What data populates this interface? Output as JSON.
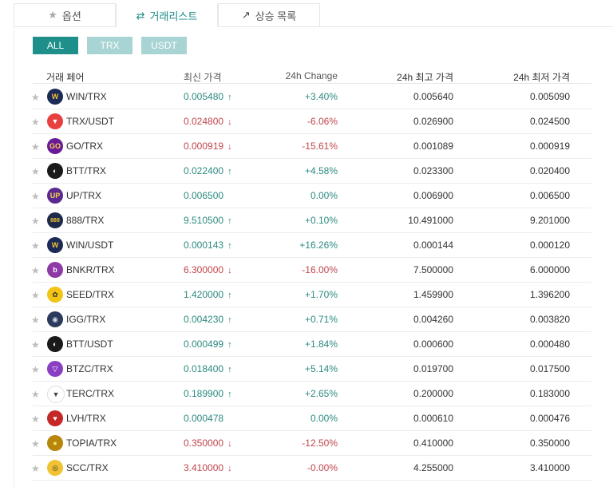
{
  "tabs": [
    {
      "label": "옵션",
      "icon": "star-icon",
      "glyph": "★"
    },
    {
      "label": "거래리스트",
      "icon": "swap-icon",
      "glyph": "⇄"
    },
    {
      "label": "상승 목록",
      "icon": "trending-up-icon",
      "glyph": "↗"
    }
  ],
  "filters": [
    "ALL",
    "TRX",
    "USDT"
  ],
  "columns": {
    "pair": "거래 페어",
    "price": "최신 가격",
    "change": "24h Change",
    "high": "24h 최고 가격",
    "low": "24h 최저 가격"
  },
  "colors": {
    "accent": "#1f8f8c",
    "up": "#2c8a80",
    "down": "#c0464d"
  },
  "rows": [
    {
      "pair": "WIN/TRX",
      "price": "0.005480",
      "dir": "up",
      "change": "+3.40%",
      "high": "0.005640",
      "low": "0.005090",
      "logo": "W",
      "logo_bg": "#1b2a57",
      "logo_fg": "#f1c232"
    },
    {
      "pair": "TRX/USDT",
      "price": "0.024800",
      "dir": "down",
      "change": "-6.06%",
      "high": "0.026900",
      "low": "0.024500",
      "logo": "▼",
      "logo_bg": "#e8403f",
      "logo_fg": "#fff"
    },
    {
      "pair": "GO/TRX",
      "price": "0.000919",
      "dir": "down",
      "change": "-15.61%",
      "high": "0.001089",
      "low": "0.000919",
      "logo": "GO",
      "logo_bg": "#6a1b9a",
      "logo_fg": "#f6d24a"
    },
    {
      "pair": "BTT/TRX",
      "price": "0.022400",
      "dir": "up",
      "change": "+4.58%",
      "high": "0.023300",
      "low": "0.020400",
      "logo": "◐",
      "logo_bg": "#1a1a1a",
      "logo_fg": "#fff"
    },
    {
      "pair": "UP/TRX",
      "price": "0.006500",
      "dir": "flat",
      "change": "0.00%",
      "high": "0.006900",
      "low": "0.006500",
      "logo": "UP",
      "logo_bg": "#5a2a91",
      "logo_fg": "#f6d24a"
    },
    {
      "pair": "888/TRX",
      "price": "9.510500",
      "dir": "up",
      "change": "+0.10%",
      "high": "10.491000",
      "low": "9.201000",
      "logo": "888",
      "logo_bg": "#1e2a4a",
      "logo_fg": "#f1c232"
    },
    {
      "pair": "WIN/USDT",
      "price": "0.000143",
      "dir": "up",
      "change": "+16.26%",
      "high": "0.000144",
      "low": "0.000120",
      "logo": "W",
      "logo_bg": "#1b2a57",
      "logo_fg": "#f1c232"
    },
    {
      "pair": "BNKR/TRX",
      "price": "6.300000",
      "dir": "down",
      "change": "-16.00%",
      "high": "7.500000",
      "low": "6.000000",
      "logo": "b",
      "logo_bg": "#8e3aa6",
      "logo_fg": "#fff"
    },
    {
      "pair": "SEED/TRX",
      "price": "1.420000",
      "dir": "up",
      "change": "+1.70%",
      "high": "1.459900",
      "low": "1.396200",
      "logo": "✿",
      "logo_bg": "#f3c316",
      "logo_fg": "#333"
    },
    {
      "pair": "IGG/TRX",
      "price": "0.004230",
      "dir": "up",
      "change": "+0.71%",
      "high": "0.004260",
      "low": "0.003820",
      "logo": "◉",
      "logo_bg": "#2b3a5c",
      "logo_fg": "#cfd8e3"
    },
    {
      "pair": "BTT/USDT",
      "price": "0.000499",
      "dir": "up",
      "change": "+1.84%",
      "high": "0.000600",
      "low": "0.000480",
      "logo": "◐",
      "logo_bg": "#1a1a1a",
      "logo_fg": "#fff"
    },
    {
      "pair": "BTZC/TRX",
      "price": "0.018400",
      "dir": "up",
      "change": "+5.14%",
      "high": "0.019700",
      "low": "0.017500",
      "logo": "▽",
      "logo_bg": "#8a3fc2",
      "logo_fg": "#fff"
    },
    {
      "pair": "TERC/TRX",
      "price": "0.189900",
      "dir": "up",
      "change": "+2.65%",
      "high": "0.200000",
      "low": "0.183000",
      "logo": "▼",
      "logo_bg": "#ffffff",
      "logo_fg": "#444"
    },
    {
      "pair": "LVH/TRX",
      "price": "0.000478",
      "dir": "flat",
      "change": "0.00%",
      "high": "0.000610",
      "low": "0.000476",
      "logo": "♥",
      "logo_bg": "#c62828",
      "logo_fg": "#fff"
    },
    {
      "pair": "TOPIA/TRX",
      "price": "0.350000",
      "dir": "down",
      "change": "-12.50%",
      "high": "0.410000",
      "low": "0.350000",
      "logo": "●",
      "logo_bg": "#b8860b",
      "logo_fg": "#f6e27a"
    },
    {
      "pair": "SCC/TRX",
      "price": "3.410000",
      "dir": "down",
      "change": "-0.00%",
      "high": "4.255000",
      "low": "3.410000",
      "logo": "◎",
      "logo_bg": "#f1c232",
      "logo_fg": "#333"
    }
  ]
}
